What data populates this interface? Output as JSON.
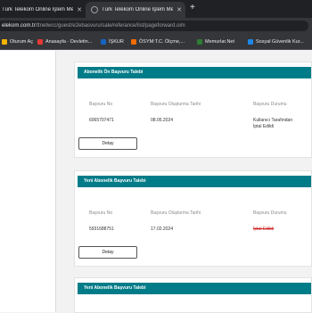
{
  "browser": {
    "tabs": [
      {
        "title": "Türk Telekom Online İşlem Mer",
        "close": "✕"
      },
      {
        "title": "Türk Telekom Online İşlem Mer",
        "close": "✕"
      }
    ],
    "new_tab": "+",
    "url_domain": "elekom.com.tr",
    "url_path": "/ttnetwcc/guest/e2ebasvuru/sale/referance/list/pageforward.oim"
  },
  "bookmarks": [
    {
      "label": "Oturum Aç",
      "color": "#f4b400"
    },
    {
      "label": "Anasayfa - Devletin...",
      "color": "#e53935"
    },
    {
      "label": "İŞKUR",
      "color": "#1565c0"
    },
    {
      "label": "ÖSYM:T.C. Ölçme,...",
      "color": "#ef6c00"
    },
    {
      "label": "Memurlar.Net",
      "color": "#2e7d32"
    },
    {
      "label": "Sosyal Güvenlik Kur...",
      "color": "#1e88e5"
    }
  ],
  "cards": [
    {
      "header": "Abonelik Ön Başvuru Talebi",
      "labels": {
        "no": "Başvuru No",
        "date": "Başvuru Oluşturma Tarihi",
        "status": "Başvuru Durumu"
      },
      "values": {
        "no": "6065707471",
        "date": "08.05.2024",
        "status": "Kullanıcı Tarafından İptal Edildi"
      },
      "button": "Detay"
    },
    {
      "header": "Yeni Abonelik Başvuru Talebi",
      "labels": {
        "no": "Başvuru No",
        "date": "Başvuru Oluşturma Tarihi",
        "status": "Başvuru Durumu"
      },
      "values": {
        "no": "5931688751",
        "date": "17.02.2024",
        "status": "İptal Edildi"
      },
      "button": "Detay"
    },
    {
      "header": "Yeni Abonelik Başvuru Talebi"
    }
  ],
  "colors": {
    "header_teal": "#007c89",
    "cancel_red": "#cc2222"
  }
}
